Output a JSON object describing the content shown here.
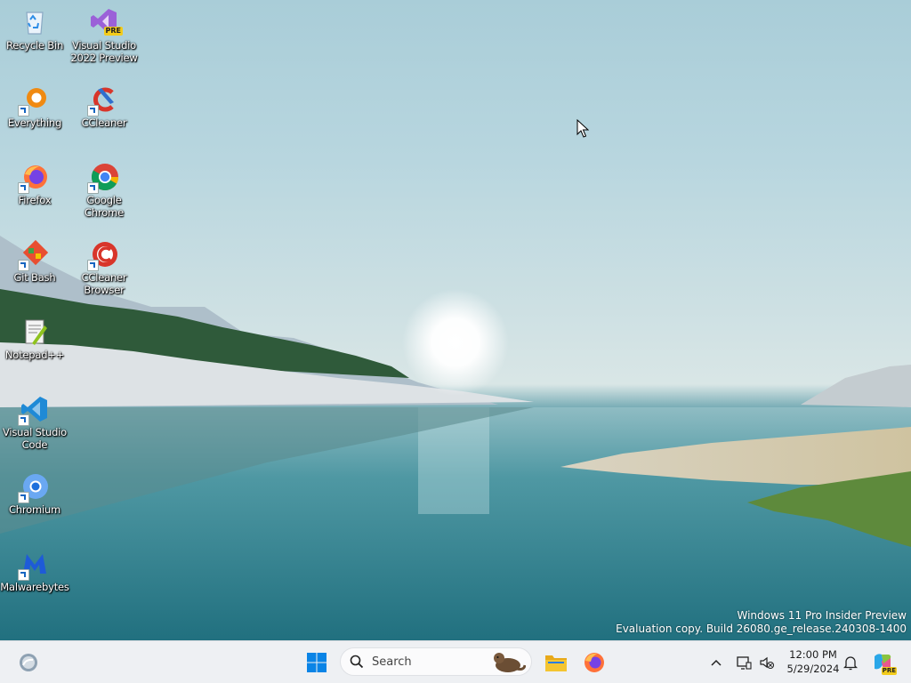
{
  "desktop": {
    "icons": [
      {
        "label": "Recycle Bin"
      },
      {
        "label": "Visual Studio 2022 Preview",
        "badge": "PRE"
      },
      {
        "label": "Everything"
      },
      {
        "label": "CCleaner"
      },
      {
        "label": "Firefox"
      },
      {
        "label": "Google Chrome"
      },
      {
        "label": "Git Bash"
      },
      {
        "label": "CCleaner Browser"
      },
      {
        "label": "Notepad++"
      },
      {
        "label": "Visual Studio Code"
      },
      {
        "label": "Chromium"
      },
      {
        "label": "Malwarebytes"
      }
    ]
  },
  "watermark": {
    "line1": "Windows 11 Pro Insider Preview",
    "line2": "Evaluation copy. Build 26080.ge_release.240308-1400"
  },
  "taskbar": {
    "search_placeholder": "Search",
    "clock_time": "12:00 PM",
    "clock_date": "5/29/2024",
    "copilot_badge": "PRE"
  },
  "colors": {
    "taskbar_bg": "#eef0f3",
    "windows_blue": "#0078d4",
    "folder_yellow": "#f4c531"
  }
}
